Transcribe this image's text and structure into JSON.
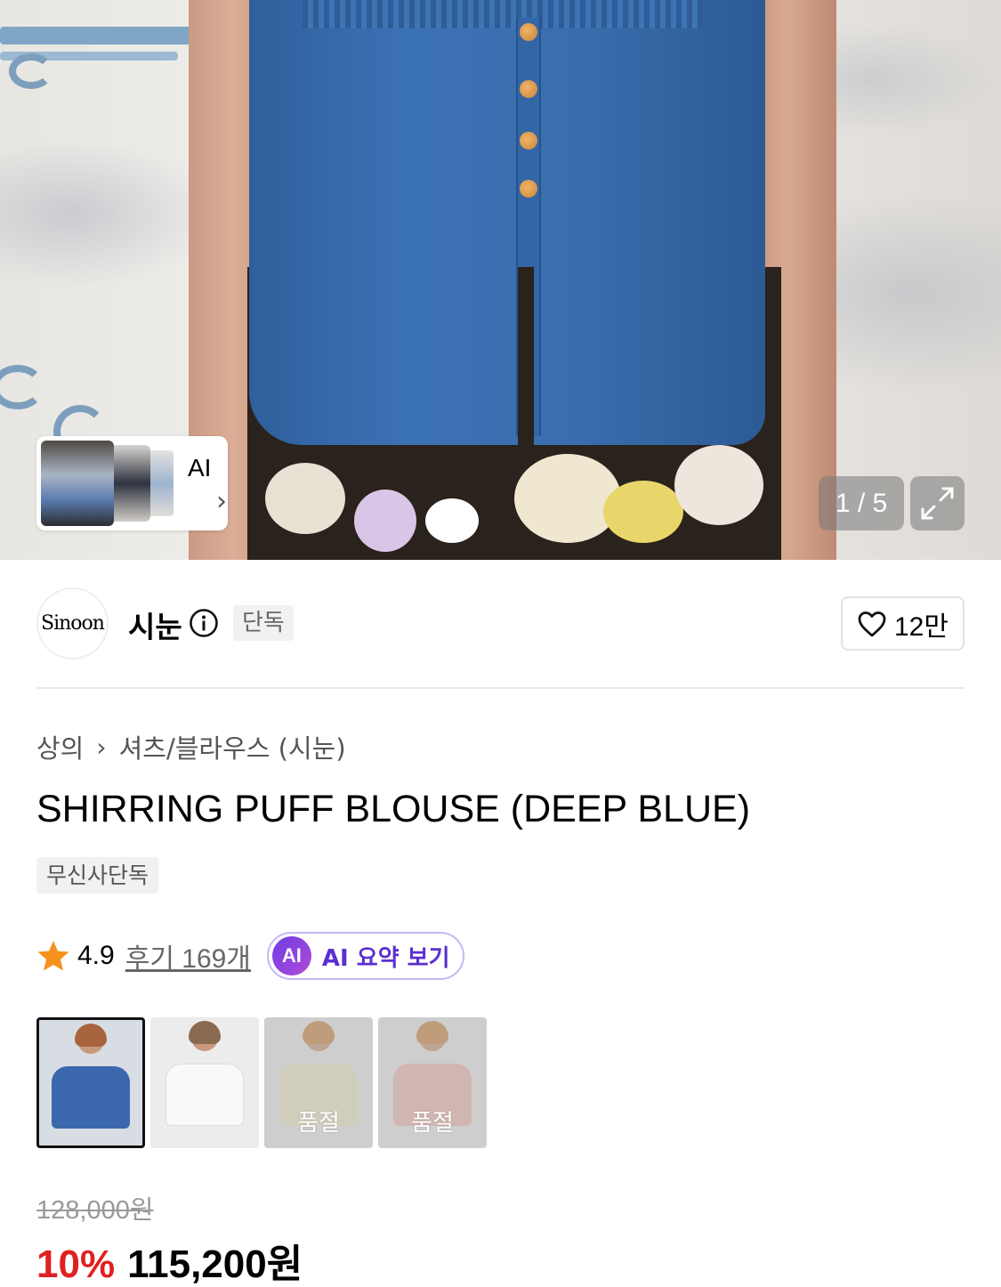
{
  "gallery": {
    "ai_card_label": "AI",
    "counter": "1 / 5"
  },
  "brand": {
    "logo_text": "Sinoon",
    "name": "시눈",
    "exclusive_badge": "단독",
    "like_count": "12만"
  },
  "product": {
    "breadcrumb": [
      "상의",
      "셔츠/블라우스 (시눈)"
    ],
    "title": "SHIRRING PUFF BLOUSE (DEEP BLUE)",
    "tag": "무신사단독",
    "rating": "4.9",
    "reviews_label": "후기 169개",
    "ai_summary_badge": "AI",
    "ai_summary_label": "AI 요약 보기"
  },
  "colors": [
    {
      "label": "",
      "selected": true,
      "color": "#3b68ad"
    },
    {
      "label": "",
      "selected": false,
      "color": "#f5f5f2"
    },
    {
      "label": "품절",
      "selected": false,
      "color": "#e9e2c4"
    },
    {
      "label": "품절",
      "selected": false,
      "color": "#e8b9ad"
    }
  ],
  "price": {
    "original": "128,000원",
    "discount": "10%",
    "sale": "115,200원"
  },
  "accent": {
    "discount_color": "#e02020",
    "ai_color": "#5b2fd0"
  }
}
